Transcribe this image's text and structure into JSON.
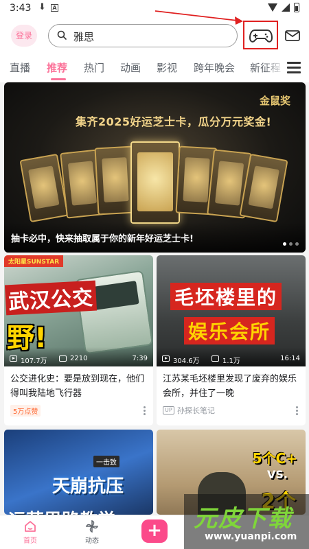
{
  "status_bar": {
    "time": "3:43",
    "app_badge": "A"
  },
  "header": {
    "login_label": "登录",
    "search_value": "雅思"
  },
  "tabs": {
    "items": [
      "直播",
      "推荐",
      "热门",
      "动画",
      "影视",
      "跨年晚会",
      "新征程"
    ],
    "active": "推荐"
  },
  "banner": {
    "headline": "集齐2025好运芝士卡，瓜分万元奖金!",
    "brand": "金鼠奖",
    "caption": "抽卡必中，快来抽取属于你的新年好运芝士卡!",
    "page_count": 3,
    "current_page": 1
  },
  "videos": [
    {
      "cover_brand": "太阳星SUNSTAR",
      "cover_line1": "武汉公交",
      "cover_line2": "野!",
      "views": "107.7万",
      "danmaku": "2210",
      "duration": "7:39",
      "title": "公交进化史：要是放到现在，他们得叫我陆地飞行器",
      "badge": "5万点赞"
    },
    {
      "cover_line1": "毛坯楼里的",
      "cover_line2": "娱乐会所",
      "views": "304.6万",
      "danmaku": "1.1万",
      "duration": "16:14",
      "title": "江苏某毛坯楼里发现了废弃的娱乐会所，并住了一晚",
      "up_label": "UP",
      "uploader": "孙探长笔记"
    },
    {
      "cover_tag": "一击致",
      "cover_line1": "天崩抗压",
      "cover_line2": "运营思路教学"
    },
    {
      "cover_line1": "5个C+",
      "cover_line2": "VS.",
      "cover_line3": "2个"
    }
  ],
  "bottom_nav": {
    "home_label": "首页",
    "dynamic_label": "动态",
    "publish_label": "+"
  },
  "watermark": {
    "main": "元皮下载",
    "url": "www.yuanpi.com"
  },
  "colors": {
    "accent": "#fb7299",
    "annotation": "#e02020"
  }
}
